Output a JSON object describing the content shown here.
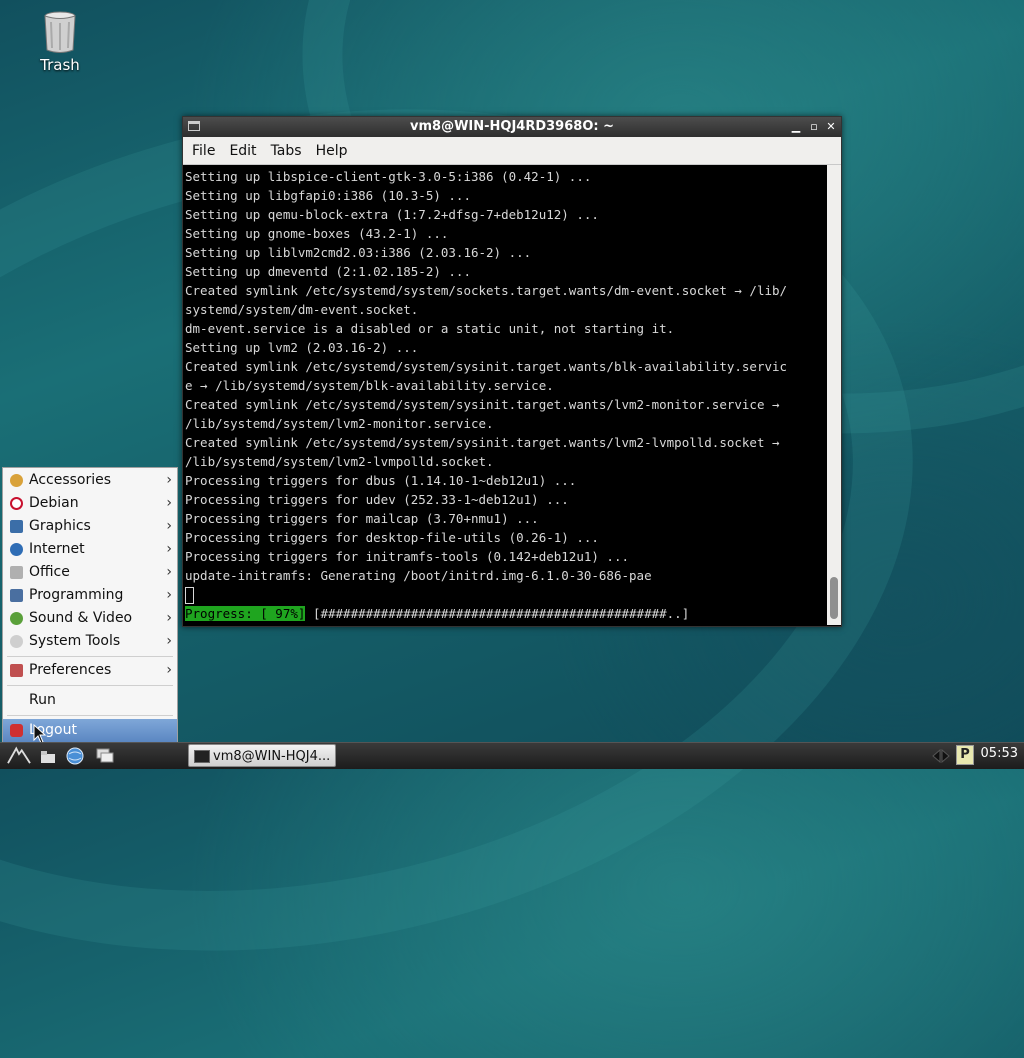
{
  "desktop": {
    "trash_label": "Trash"
  },
  "window": {
    "title": "vm8@WIN-HQJ4RD3968O: ~",
    "menu": [
      "File",
      "Edit",
      "Tabs",
      "Help"
    ]
  },
  "terminal": {
    "lines": [
      "Setting up libspice-client-gtk-3.0-5:i386 (0.42-1) ...",
      "Setting up libgfapi0:i386 (10.3-5) ...",
      "Setting up qemu-block-extra (1:7.2+dfsg-7+deb12u12) ...",
      "Setting up gnome-boxes (43.2-1) ...",
      "Setting up liblvm2cmd2.03:i386 (2.03.16-2) ...",
      "Setting up dmeventd (2:1.02.185-2) ...",
      "Created symlink /etc/systemd/system/sockets.target.wants/dm-event.socket → /lib/",
      "systemd/system/dm-event.socket.",
      "dm-event.service is a disabled or a static unit, not starting it.",
      "Setting up lvm2 (2.03.16-2) ...",
      "Created symlink /etc/systemd/system/sysinit.target.wants/blk-availability.servic",
      "e → /lib/systemd/system/blk-availability.service.",
      "Created symlink /etc/systemd/system/sysinit.target.wants/lvm2-monitor.service →",
      "/lib/systemd/system/lvm2-monitor.service.",
      "Created symlink /etc/systemd/system/sysinit.target.wants/lvm2-lvmpolld.socket →",
      "/lib/systemd/system/lvm2-lvmpolld.socket.",
      "Processing triggers for dbus (1.14.10-1~deb12u1) ...",
      "Processing triggers for udev (252.33-1~deb12u1) ...",
      "Processing triggers for mailcap (3.70+nmu1) ...",
      "Processing triggers for desktop-file-utils (0.26-1) ...",
      "Processing triggers for initramfs-tools (0.142+deb12u1) ...",
      "update-initramfs: Generating /boot/initrd.img-6.1.0-30-686-pae"
    ],
    "progress_label": "Progress: [ 97%]",
    "progress_bar": " [##############################################..]",
    "progress_percent": 97
  },
  "start_menu": {
    "items": [
      {
        "label": "Accessories",
        "icon": "accessories-icon",
        "color": "#d9a23a"
      },
      {
        "label": "Debian",
        "icon": "debian-swirl-icon",
        "color": "#c8102e"
      },
      {
        "label": "Graphics",
        "icon": "graphics-icon",
        "color": "#3b6ea8"
      },
      {
        "label": "Internet",
        "icon": "globe-icon",
        "color": "#2f6db5"
      },
      {
        "label": "Office",
        "icon": "office-icon",
        "color": "#9a9a9a"
      },
      {
        "label": "Programming",
        "icon": "programming-icon",
        "color": "#4a6fa0"
      },
      {
        "label": "Sound & Video",
        "icon": "sound-video-icon",
        "color": "#5aa03a"
      },
      {
        "label": "System Tools",
        "icon": "system-tools-icon",
        "color": "#bdbdbd"
      }
    ],
    "preferences": {
      "label": "Preferences",
      "icon": "preferences-icon",
      "color": "#c05050"
    },
    "run": {
      "label": "Run"
    },
    "logout": {
      "label": "Logout",
      "icon": "logout-icon",
      "color": "#d03030"
    }
  },
  "taskbar": {
    "task_label": "vm8@WIN-HQJ4...",
    "clock": "05:53"
  }
}
